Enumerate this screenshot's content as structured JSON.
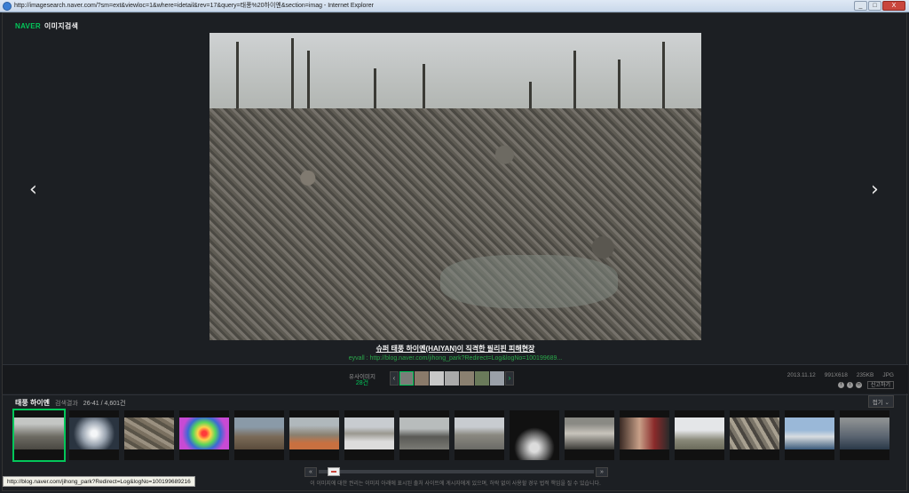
{
  "window": {
    "title": "http://imagesearch.naver.com/?sm=ext&viewloc=1&where=idetail&rev=17&query=태풍%20하이옌&section=imag - Internet Explorer",
    "controls": [
      "_",
      "□",
      "X"
    ]
  },
  "header": {
    "brand": "NAVER",
    "section": "이미지검색"
  },
  "viewer": {
    "prev_icon": "‹",
    "next_icon": "›",
    "caption": "슈퍼 태풍 하이옌(HAIYAN)이 직격한 필리핀 피해현장",
    "source": "eyvall : http://blog.naver.com/jihong_park?Redirect=Log&logNo=100199689..."
  },
  "info": {
    "date": "2013.11.12",
    "dimensions": "991X618",
    "size": "235KB",
    "format": "JPG",
    "report": "신고하기",
    "share_icons": [
      "f",
      "t",
      "m"
    ]
  },
  "similar": {
    "label": "유사이미지",
    "count": "28건",
    "prev": "‹",
    "next": "›"
  },
  "results": {
    "query": "태풍 하이옌",
    "label": "검색결과",
    "count": "26-41 / 4,601건",
    "fold": "접기 ⌄"
  },
  "pager": {
    "prev": "«",
    "next": "»"
  },
  "notice": "이 이미지에 대한 권리는 이미지 아래에 표시된 출처 사이트에 게시자에게 있으며, 허락 없이 사용할 경우 법적 책임을 질 수 있습니다.",
  "status_bar": "http://blog.naver.com/jihong_park?Redirect=Log&logNo=100199689216",
  "colors": {
    "accent": "#03c75a",
    "background": "#1c1f23",
    "titlebar": "#dfe9f5"
  }
}
